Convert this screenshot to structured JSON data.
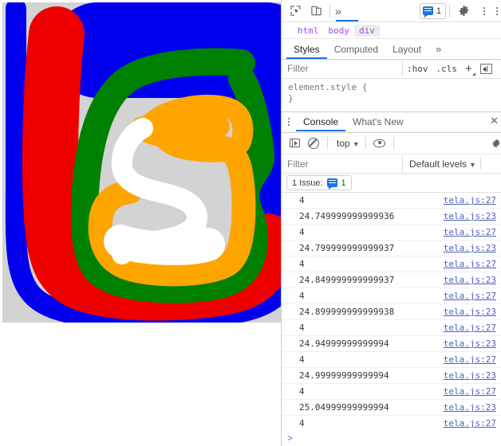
{
  "page": {
    "canvas": {
      "background_color": "#d3d3d3",
      "description": "freehand spiral drawing",
      "stroke_colors": {
        "blue": "#0000ee",
        "red": "#ee0000",
        "green": "#008000",
        "orange": "#ffa500",
        "white": "#ffffff"
      }
    }
  },
  "devtools": {
    "toolbar": {
      "inspect_icon": "inspect-cursor-icon",
      "device_icon": "device-toolbar-icon",
      "more_tabs": "»",
      "issues_count": "1",
      "issues_icon": "message-issue-icon",
      "settings_icon": "gear-icon",
      "menu_icon": "kebab-menu-icon"
    },
    "breadcrumb": [
      {
        "label": "html",
        "selected": false
      },
      {
        "label": "body",
        "selected": false
      },
      {
        "label": "div",
        "selected": true
      }
    ],
    "styles_pane": {
      "tabs": [
        {
          "label": "Styles",
          "active": true
        },
        {
          "label": "Computed",
          "active": false
        },
        {
          "label": "Layout",
          "active": false
        },
        {
          "label": "»",
          "active": false
        }
      ],
      "filter_placeholder": "Filter",
      "hov_label": ":hov",
      "cls_label": ".cls",
      "new_rule_label": "+",
      "sidebar_toggle_icon": "style-sidebar-toggle-icon",
      "rule_selector": "element.style {",
      "rule_close": "}"
    },
    "drawer": {
      "menu_icon": "kebab-menu-icon",
      "tabs": [
        {
          "label": "Console",
          "active": true
        },
        {
          "label": "What's New",
          "active": false
        }
      ],
      "close_label": "✕",
      "console_toolbar": {
        "sidebar_icon": "console-sidebar-toggle-icon",
        "clear_icon": "clear-console-icon",
        "context": "top",
        "context_caret": "▼",
        "eye_icon": "live-expression-eye-icon",
        "settings_icon": "gear-icon"
      },
      "filter_placeholder": "Filter",
      "levels_label": "Default levels",
      "levels_caret": "▼",
      "issues_text": "1 Issue:",
      "issues_count": "1",
      "issues_icon": "message-issue-icon",
      "prompt": ">",
      "log_rows": [
        {
          "value": "4",
          "source": "tela.js:27"
        },
        {
          "value": "24.749999999999936",
          "source": "tela.js:23"
        },
        {
          "value": "4",
          "source": "tela.js:27"
        },
        {
          "value": "24.799999999999937",
          "source": "tela.js:23"
        },
        {
          "value": "4",
          "source": "tela.js:27"
        },
        {
          "value": "24.849999999999937",
          "source": "tela.js:23"
        },
        {
          "value": "4",
          "source": "tela.js:27"
        },
        {
          "value": "24.899999999999938",
          "source": "tela.js:23"
        },
        {
          "value": "4",
          "source": "tela.js:27"
        },
        {
          "value": "24.94999999999994",
          "source": "tela.js:23"
        },
        {
          "value": "4",
          "source": "tela.js:27"
        },
        {
          "value": "24.99999999999994",
          "source": "tela.js:23"
        },
        {
          "value": "4",
          "source": "tela.js:27"
        },
        {
          "value": "25.04999999999994",
          "source": "tela.js:23"
        },
        {
          "value": "4",
          "source": "tela.js:27"
        }
      ]
    }
  }
}
